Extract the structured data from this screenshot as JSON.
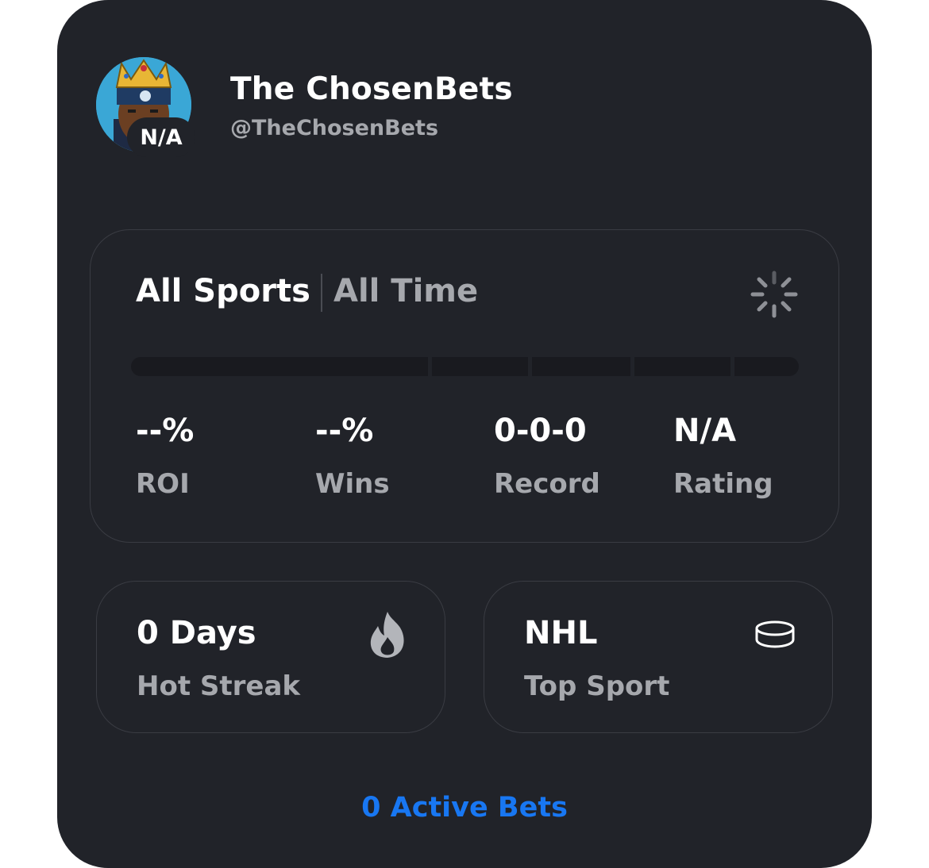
{
  "profile": {
    "display_name": "The ChosenBets",
    "handle": "@TheChosenBets",
    "badge": "N/A"
  },
  "stats": {
    "sport_filter": "All Sports",
    "time_filter": "All Time",
    "loading_icon": "spinner-icon",
    "items": [
      {
        "value": "--%",
        "label": "ROI"
      },
      {
        "value": "--%",
        "label": "Wins"
      },
      {
        "value": "0-0-0",
        "label": "Record"
      },
      {
        "value": "N/A",
        "label": "Rating"
      }
    ]
  },
  "tiles": {
    "streak": {
      "value": "0 Days",
      "label": "Hot Streak",
      "icon": "flame-icon"
    },
    "top_sport": {
      "value": "NHL",
      "label": "Top Sport",
      "icon": "hockey-puck-icon"
    }
  },
  "footer": {
    "active_bets": "0 Active Bets"
  },
  "colors": {
    "card_bg": "#212329",
    "accent": "#1877f2",
    "muted_text": "#a6a8ad",
    "border": "#3a3c43"
  }
}
